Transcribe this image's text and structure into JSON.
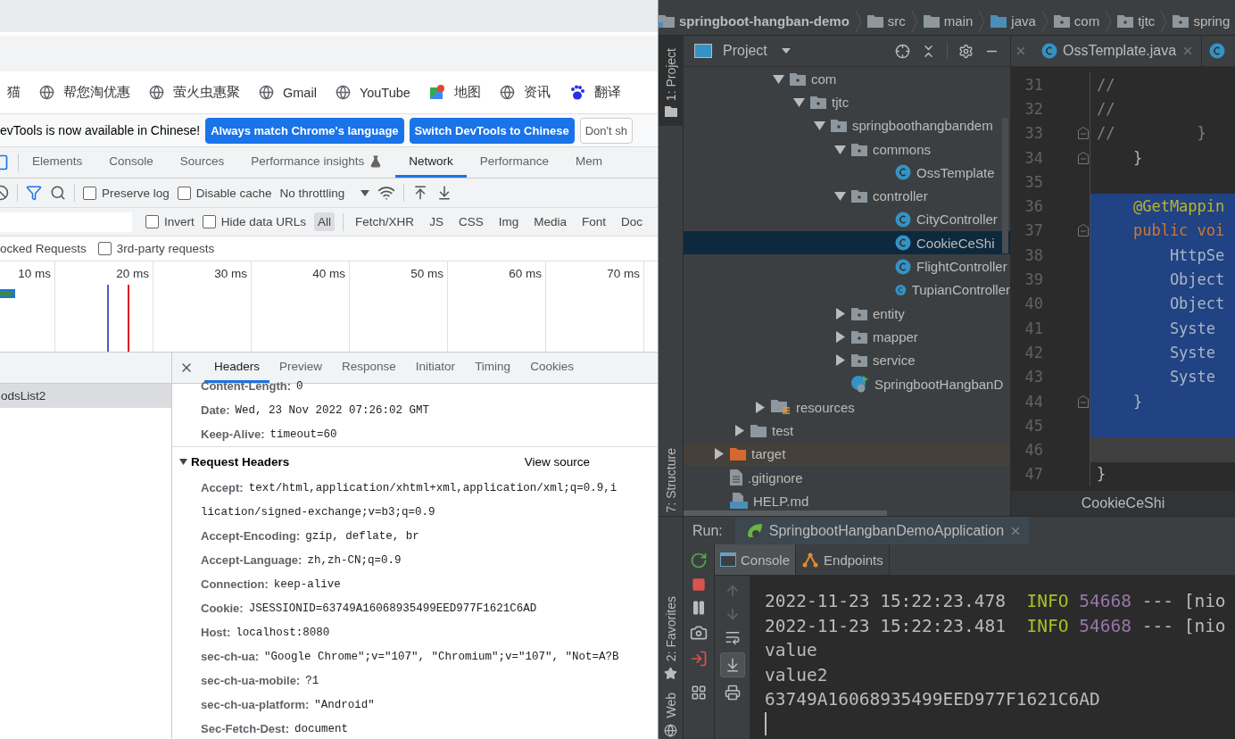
{
  "browser": {
    "bookmarks": [
      {
        "label": "猫",
        "kind": "plain"
      },
      {
        "label": "帮您淘优惠",
        "kind": "web"
      },
      {
        "label": "萤火虫惠聚",
        "kind": "web"
      },
      {
        "label": "Gmail",
        "kind": "web"
      },
      {
        "label": "YouTube",
        "kind": "web"
      },
      {
        "label": "地图",
        "kind": "maps"
      },
      {
        "label": "资讯",
        "kind": "web"
      },
      {
        "label": "翻译",
        "kind": "translate"
      }
    ],
    "banner": {
      "message": "evTools is now available in Chinese!",
      "buttons": [
        {
          "label": "Always match Chrome's language",
          "kind": "primary"
        },
        {
          "label": "Switch DevTools to Chinese",
          "kind": "primary"
        },
        {
          "label": "Don't sh",
          "kind": "secondary"
        }
      ]
    },
    "devtools_tabs": [
      {
        "label": "Elements",
        "selected": false,
        "experimental": false
      },
      {
        "label": "Console",
        "selected": false,
        "experimental": false
      },
      {
        "label": "Sources",
        "selected": false,
        "experimental": false
      },
      {
        "label": "Performance insights",
        "selected": false,
        "experimental": true
      },
      {
        "label": "Network",
        "selected": true,
        "experimental": false
      },
      {
        "label": "Performance",
        "selected": false,
        "experimental": false
      },
      {
        "label": "Mem",
        "selected": false,
        "experimental": false
      }
    ],
    "toolbar": {
      "checkboxes": [
        {
          "label": "Preserve log",
          "checked": false
        },
        {
          "label": "Disable cache",
          "checked": false
        }
      ],
      "throttling": "No throttling"
    },
    "filter": {
      "checkboxes": [
        {
          "label": "Invert",
          "checked": false
        },
        {
          "label": "Hide data URLs",
          "checked": false
        }
      ],
      "types": [
        {
          "label": "All",
          "selected": true
        },
        {
          "label": "Fetch/XHR",
          "selected": false
        },
        {
          "label": "JS",
          "selected": false
        },
        {
          "label": "CSS",
          "selected": false
        },
        {
          "label": "Img",
          "selected": false
        },
        {
          "label": "Media",
          "selected": false
        },
        {
          "label": "Font",
          "selected": false
        },
        {
          "label": "Doc",
          "selected": false
        }
      ]
    },
    "request_filters": [
      {
        "label": "ocked Requests"
      },
      {
        "label": "3rd-party requests",
        "checked": false
      }
    ],
    "timeline_ticks": [
      "10 ms",
      "20 ms",
      "30 ms",
      "40 ms",
      "50 ms",
      "60 ms",
      "70 ms"
    ],
    "requests": [
      {
        "name": "odsList2",
        "selected": true
      }
    ],
    "detail_tabs": [
      {
        "label": "Headers",
        "selected": true
      },
      {
        "label": "Preview",
        "selected": false
      },
      {
        "label": "Response",
        "selected": false
      },
      {
        "label": "Initiator",
        "selected": false
      },
      {
        "label": "Timing",
        "selected": false
      },
      {
        "label": "Cookies",
        "selected": false
      }
    ],
    "response_headers": [
      {
        "name": "Content-Length:",
        "value": "0"
      },
      {
        "name": "Date:",
        "value": "Wed, 23 Nov 2022 07:26:02 GMT"
      },
      {
        "name": "Keep-Alive:",
        "value": "timeout=60"
      }
    ],
    "request_headers": {
      "title": "Request Headers",
      "expanded": true,
      "view_source": "View source",
      "rows": [
        {
          "name": "Accept:",
          "value": "text/html,application/xhtml+xml,application/xml;q=0.9,i",
          "continuation": "lication/signed-exchange;v=b3;q=0.9"
        },
        {
          "name": "Accept-Encoding:",
          "value": "gzip, deflate, br"
        },
        {
          "name": "Accept-Language:",
          "value": "zh,zh-CN;q=0.9"
        },
        {
          "name": "Connection:",
          "value": "keep-alive"
        },
        {
          "name": "Cookie:",
          "value": "JSESSIONID=63749A16068935499EED977F1621C6AD"
        },
        {
          "name": "Host:",
          "value": "localhost:8080"
        },
        {
          "name": "sec-ch-ua:",
          "value": "\"Google Chrome\";v=\"107\", \"Chromium\";v=\"107\", \"Not=A?B"
        },
        {
          "name": "sec-ch-ua-mobile:",
          "value": "?1"
        },
        {
          "name": "sec-ch-ua-platform:",
          "value": "\"Android\""
        },
        {
          "name": "Sec-Fetch-Dest:",
          "value": "document"
        }
      ]
    }
  },
  "ide": {
    "breadcrumbs": [
      {
        "label": "springboot-hangban-demo",
        "kind": "module"
      },
      {
        "label": "src",
        "kind": "folder"
      },
      {
        "label": "main",
        "kind": "folder"
      },
      {
        "label": "java",
        "kind": "source"
      },
      {
        "label": "com",
        "kind": "package"
      },
      {
        "label": "tjtc",
        "kind": "package"
      },
      {
        "label": "spring",
        "kind": "package"
      }
    ],
    "stripe": [
      {
        "label": "1: Project",
        "selected": true
      },
      {
        "label": "7: Structure",
        "selected": false
      },
      {
        "label": "2: Favorites",
        "selected": false
      },
      {
        "label": "Web",
        "selected": false
      }
    ],
    "project_view": "Project",
    "tree": [
      {
        "label": "com",
        "kind": "package",
        "expanded": true,
        "selected": false,
        "children": [
          {
            "label": "tjtc",
            "kind": "package",
            "expanded": true,
            "selected": false,
            "children": [
              {
                "label": "springboothangbandem",
                "kind": "package",
                "expanded": true,
                "selected": false,
                "children": [
                  {
                    "label": "commons",
                    "kind": "package",
                    "expanded": true,
                    "selected": false,
                    "children": [
                      {
                        "label": "OssTemplate",
                        "kind": "class",
                        "selected": false
                      }
                    ]
                  },
                  {
                    "label": "controller",
                    "kind": "package",
                    "expanded": true,
                    "selected": false,
                    "children": [
                      {
                        "label": "CityController",
                        "kind": "class",
                        "selected": false
                      },
                      {
                        "label": "CookieCeShi",
                        "kind": "class",
                        "selected": true
                      },
                      {
                        "label": "FlightController",
                        "kind": "class",
                        "selected": false
                      },
                      {
                        "label": "TupianController",
                        "kind": "class",
                        "selected": false
                      }
                    ]
                  },
                  {
                    "label": "entity",
                    "kind": "package",
                    "expanded": false,
                    "selected": false
                  },
                  {
                    "label": "mapper",
                    "kind": "package",
                    "expanded": false,
                    "selected": false
                  },
                  {
                    "label": "service",
                    "kind": "package",
                    "expanded": false,
                    "selected": false
                  },
                  {
                    "label": "SpringbootHangbanD",
                    "kind": "spring",
                    "selected": false
                  }
                ]
              }
            ]
          }
        ]
      },
      {
        "label": "resources",
        "kind": "resources",
        "expanded": false,
        "selected": false
      },
      {
        "label": "test",
        "kind": "folder",
        "expanded": false,
        "selected": false
      },
      {
        "label": "target",
        "kind": "excluded",
        "expanded": false,
        "selected": false
      },
      {
        "label": ".gitignore",
        "kind": "file",
        "selected": false
      },
      {
        "label": "HELP.md",
        "kind": "markdown",
        "selected": false
      }
    ],
    "editor_tabs": [
      {
        "label": "OssTemplate.java",
        "selected": false
      }
    ],
    "code": [
      {
        "number": "31",
        "text": "//",
        "kind": "comment",
        "selected": false,
        "current": false,
        "fold": false
      },
      {
        "number": "32",
        "text": "//",
        "kind": "comment",
        "selected": false,
        "current": false,
        "fold": false
      },
      {
        "number": "33",
        "text": "//         }",
        "kind": "comment",
        "selected": false,
        "current": false,
        "fold": true
      },
      {
        "number": "34",
        "text": "    }",
        "kind": "plain",
        "selected": false,
        "current": false,
        "fold": true
      },
      {
        "number": "35",
        "kind": "plain",
        "selected": false,
        "current": false,
        "fold": false
      },
      {
        "number": "36",
        "text": "    @GetMappin",
        "kind": "annotation",
        "selected": true,
        "current": false,
        "fold": false
      },
      {
        "number": "37",
        "text": "    public voi",
        "kind": "keyword",
        "selected": true,
        "current": false,
        "fold": true
      },
      {
        "number": "38",
        "text": "        HttpSe",
        "kind": "plain",
        "selected": true,
        "current": false,
        "fold": false
      },
      {
        "number": "39",
        "text": "        Object",
        "kind": "plain",
        "selected": true,
        "current": false,
        "fold": false
      },
      {
        "number": "40",
        "text": "        Object",
        "kind": "plain",
        "selected": true,
        "current": false,
        "fold": false
      },
      {
        "number": "41",
        "text": "        Syste",
        "kind": "plain",
        "selected": true,
        "current": false,
        "fold": false
      },
      {
        "number": "42",
        "text": "        Syste",
        "kind": "plain",
        "selected": true,
        "current": false,
        "fold": false
      },
      {
        "number": "43",
        "text": "        Syste",
        "kind": "plain",
        "selected": true,
        "current": false,
        "fold": false
      },
      {
        "number": "44",
        "text": "    }",
        "kind": "plain",
        "selected": true,
        "current": false,
        "fold": true
      },
      {
        "number": "45",
        "kind": "plain",
        "selected": true,
        "current": false,
        "fold": false
      },
      {
        "number": "46",
        "kind": "plain",
        "selected": false,
        "current": true,
        "fold": false
      },
      {
        "number": "47",
        "text": "}",
        "kind": "plain",
        "selected": false,
        "current": false,
        "fold": false
      }
    ],
    "editor_breadcrumb": "CookieCeShi",
    "run": {
      "label": "Run:",
      "config": "SpringbootHangbanDemoApplication",
      "tabs": [
        {
          "label": "Console",
          "kind": "console",
          "selected": true
        },
        {
          "label": "Endpoints",
          "kind": "endpoints",
          "selected": false
        }
      ],
      "console": [
        {
          "kind": "log",
          "time": "2022-11-23 15:22:23.478",
          "level": "INFO",
          "pid": "54668",
          "rest": "--- [nio"
        },
        {
          "kind": "log",
          "time": "2022-11-23 15:22:23.481",
          "level": "INFO",
          "pid": "54668",
          "rest": "--- [nio"
        },
        {
          "kind": "plain",
          "text": "value"
        },
        {
          "kind": "plain",
          "text": "value2"
        },
        {
          "kind": "plain",
          "text": "63749A16068935499EED977F1621C6AD"
        }
      ]
    }
  }
}
